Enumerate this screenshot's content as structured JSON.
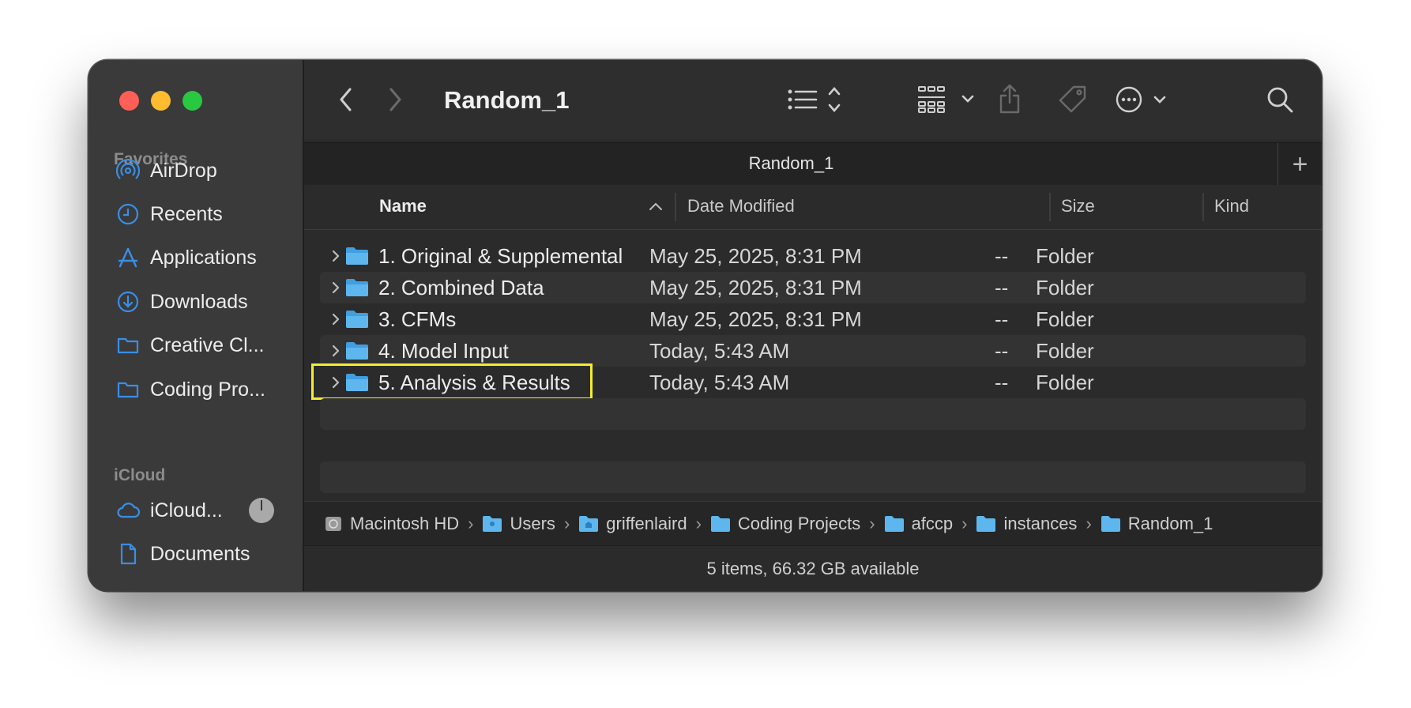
{
  "window": {
    "title": "Random_1",
    "tab_title": "Random_1"
  },
  "sidebar": {
    "sections": [
      {
        "label": "Favorites",
        "items": [
          {
            "label": "AirDrop",
            "icon": "airdrop-icon"
          },
          {
            "label": "Recents",
            "icon": "clock-icon"
          },
          {
            "label": "Applications",
            "icon": "applications-icon"
          },
          {
            "label": "Downloads",
            "icon": "download-icon"
          },
          {
            "label": "Creative Cl...",
            "icon": "folder-icon"
          },
          {
            "label": "Coding Pro...",
            "icon": "folder-icon"
          }
        ]
      },
      {
        "label": "iCloud",
        "items": [
          {
            "label": "iCloud...",
            "icon": "cloud-icon"
          },
          {
            "label": "Documents",
            "icon": "document-icon"
          }
        ]
      }
    ]
  },
  "columns": {
    "name": "Name",
    "date": "Date Modified",
    "size": "Size",
    "kind": "Kind"
  },
  "rows": [
    {
      "name": "1. Original & Supplemental",
      "date": "May 25, 2025, 8:31 PM",
      "size": "--",
      "kind": "Folder"
    },
    {
      "name": "2. Combined Data",
      "date": "May 25, 2025, 8:31 PM",
      "size": "--",
      "kind": "Folder"
    },
    {
      "name": "3. CFMs",
      "date": "May 25, 2025, 8:31 PM",
      "size": "--",
      "kind": "Folder"
    },
    {
      "name": "4. Model Input",
      "date": "Today, 5:43 AM",
      "size": "--",
      "kind": "Folder"
    },
    {
      "name": "5. Analysis & Results",
      "date": "Today, 5:43 AM",
      "size": "--",
      "kind": "Folder"
    }
  ],
  "path": [
    "Macintosh HD",
    "Users",
    "griffenlaird",
    "Coding Projects",
    "afccp",
    "instances",
    "Random_1"
  ],
  "status": "5 items, 66.32 GB available",
  "colors": {
    "accent": "#3a8ee6",
    "folder": "#5db7ee",
    "highlight": "#f4ed2f"
  }
}
